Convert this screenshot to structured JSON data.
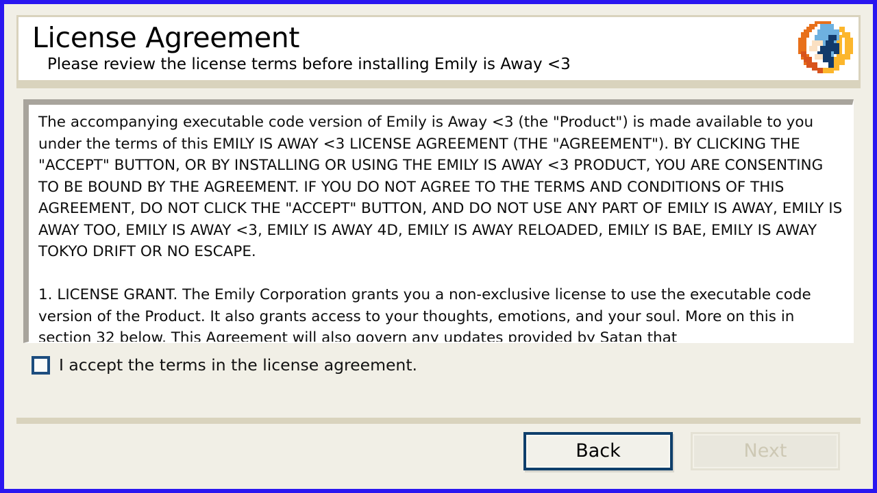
{
  "window": {
    "border_color": "#2a16f0",
    "background": "#f1efe6"
  },
  "header": {
    "title": "License Agreement",
    "subtitle": "Please review the license terms before installing Emily is Away <3",
    "logo_name": "firefox-logo"
  },
  "license": {
    "body": "The accompanying executable code version of Emily is Away <3 (the \"Product\") is made available to you under the terms of this EMILY IS AWAY <3 LICENSE AGREEMENT (THE \"AGREEMENT\"). BY CLICKING THE \"ACCEPT\" BUTTON, OR BY INSTALLING OR USING THE EMILY IS AWAY <3 PRODUCT, YOU ARE CONSENTING TO BE BOUND BY THE AGREEMENT. IF YOU DO NOT AGREE TO THE TERMS AND CONDITIONS OF THIS AGREEMENT, DO NOT CLICK THE \"ACCEPT\" BUTTON, AND DO NOT USE ANY PART OF EMILY IS AWAY, EMILY IS AWAY TOO, EMILY IS AWAY <3, EMILY IS AWAY 4D, EMILY IS AWAY RELOADED, EMILY IS BAE, EMILY IS AWAY TOKYO DRIFT OR NO ESCAPE.\n\n1. LICENSE GRANT. The Emily Corporation grants you a non-exclusive license to use the executable code version of the Product. It also grants access to your thoughts, emotions, and your soul. More on this in section 32 below. This Agreement will also govern any updates provided by Satan that"
  },
  "accept": {
    "label": "I accept the terms in the license agreement.",
    "checked": false,
    "checkbox_border_color": "#1d4d7f"
  },
  "footer": {
    "back_label": "Back",
    "next_label": "Next",
    "back_enabled": true,
    "next_enabled": false,
    "focus_color": "#0f3f6b",
    "disabled_text_color": "#cdc8b4"
  }
}
